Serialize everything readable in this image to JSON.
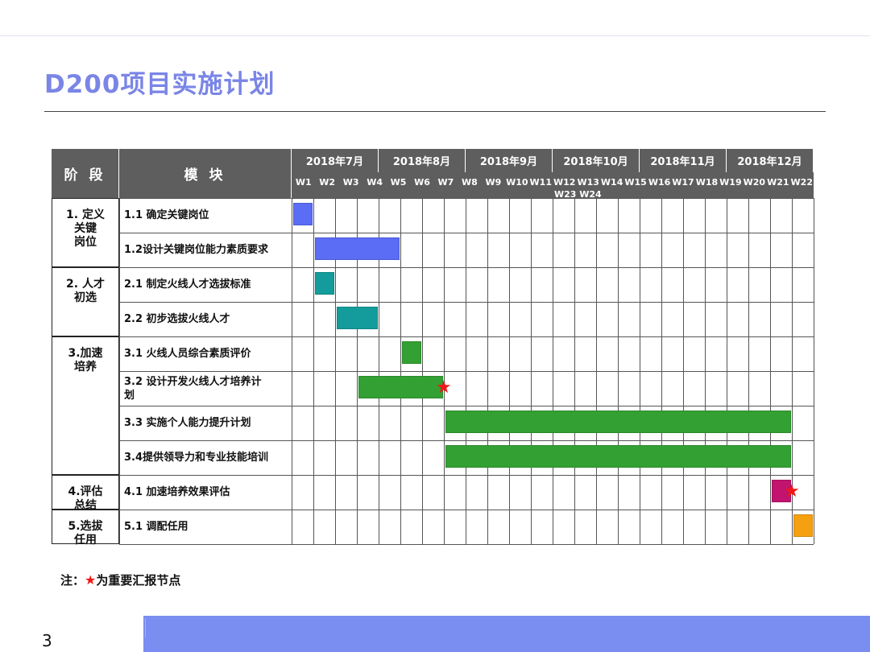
{
  "title": "D200项目实施计划",
  "header": {
    "phase_label": "阶 段",
    "module_label": "模 块",
    "months": [
      "2018年7月",
      "2018年8月",
      "2018年9月",
      "2018年10月",
      "2018年11月",
      "2018年12月"
    ],
    "weeks": [
      "W1",
      "W2",
      "W3",
      "W4",
      "W5",
      "W6",
      "W7",
      "W8",
      "W9",
      "W10",
      "W11",
      "W12",
      "W13",
      "W14",
      "W15",
      "W16",
      "W17",
      "W18",
      "W19",
      "W20",
      "W21",
      "W22"
    ],
    "weeks_overflow": "W23 W24"
  },
  "phases": [
    {
      "label": "1. 定义\n关键\n岗位",
      "rows": 2
    },
    {
      "label": "2. 人才\n初选",
      "rows": 2
    },
    {
      "label": "3.加速\n培养",
      "rows": 4
    },
    {
      "label": "4.评估\n总结",
      "rows": 1
    },
    {
      "label": "5.选拔\n任用",
      "rows": 1
    }
  ],
  "tasks": [
    {
      "label": "1.1 确定关键岗位",
      "start": 0,
      "end": 1,
      "color": "#5b6cf5"
    },
    {
      "label": "1.2设计关键岗位能力素质要求",
      "start": 1,
      "end": 5,
      "color": "#5b6cf5"
    },
    {
      "label": "2.1 制定火线人才选拔标准",
      "start": 1,
      "end": 2,
      "color": "#149c9c"
    },
    {
      "label": "2.2 初步选拔火线人才",
      "start": 2,
      "end": 4,
      "color": "#149c9c"
    },
    {
      "label": "3.1 火线人员综合素质评价",
      "start": 5,
      "end": 6,
      "color": "#33a033"
    },
    {
      "label": "3.2 设计开发火线人才培养计\n划",
      "start": 3,
      "end": 7,
      "color": "#33a033",
      "milestone_at": 7
    },
    {
      "label": "3.3 实施个人能力提升计划",
      "start": 7,
      "end": 23,
      "color": "#33a033"
    },
    {
      "label": "3.4提供领导力和专业技能培训",
      "start": 7,
      "end": 23,
      "color": "#33a033"
    },
    {
      "label": "4.1 加速培养效果评估",
      "start": 22,
      "end": 23,
      "color": "#c2146f",
      "milestone_at": 23
    },
    {
      "label": "5.1 调配任用",
      "start": 23,
      "end": 24,
      "color": "#f5a010"
    }
  ],
  "note": {
    "prefix": "注：",
    "star": "★",
    "text": "为重要汇报节点"
  },
  "page_number": "3",
  "milestone_color": "#f21616"
}
